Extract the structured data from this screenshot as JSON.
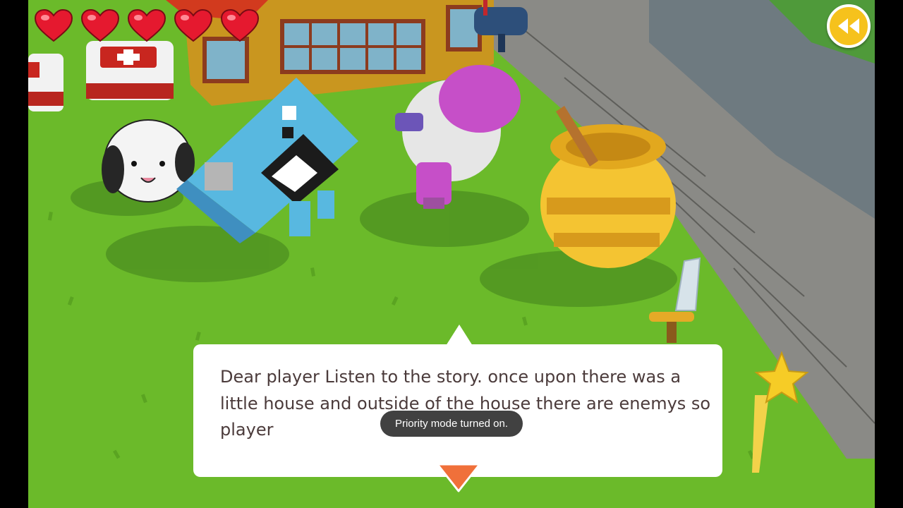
{
  "hud": {
    "hearts_full": 5,
    "hearts_total": 5,
    "heart_icon": "heart-icon",
    "rewind_icon": "rewind-icon"
  },
  "dialog": {
    "text": "Dear player Listen to the story. once upon there was a little house and outside of the house there are enemys so player",
    "continue_icon": "down-arrow-icon"
  },
  "toast": {
    "text": "Priority mode turned on."
  },
  "colors": {
    "grass": "#6fbf2b",
    "heart": "#e5192f",
    "rewind_button": "#f6c21c",
    "continue_arrow": "#f0703a",
    "dialog_text": "#4b3b3b"
  }
}
